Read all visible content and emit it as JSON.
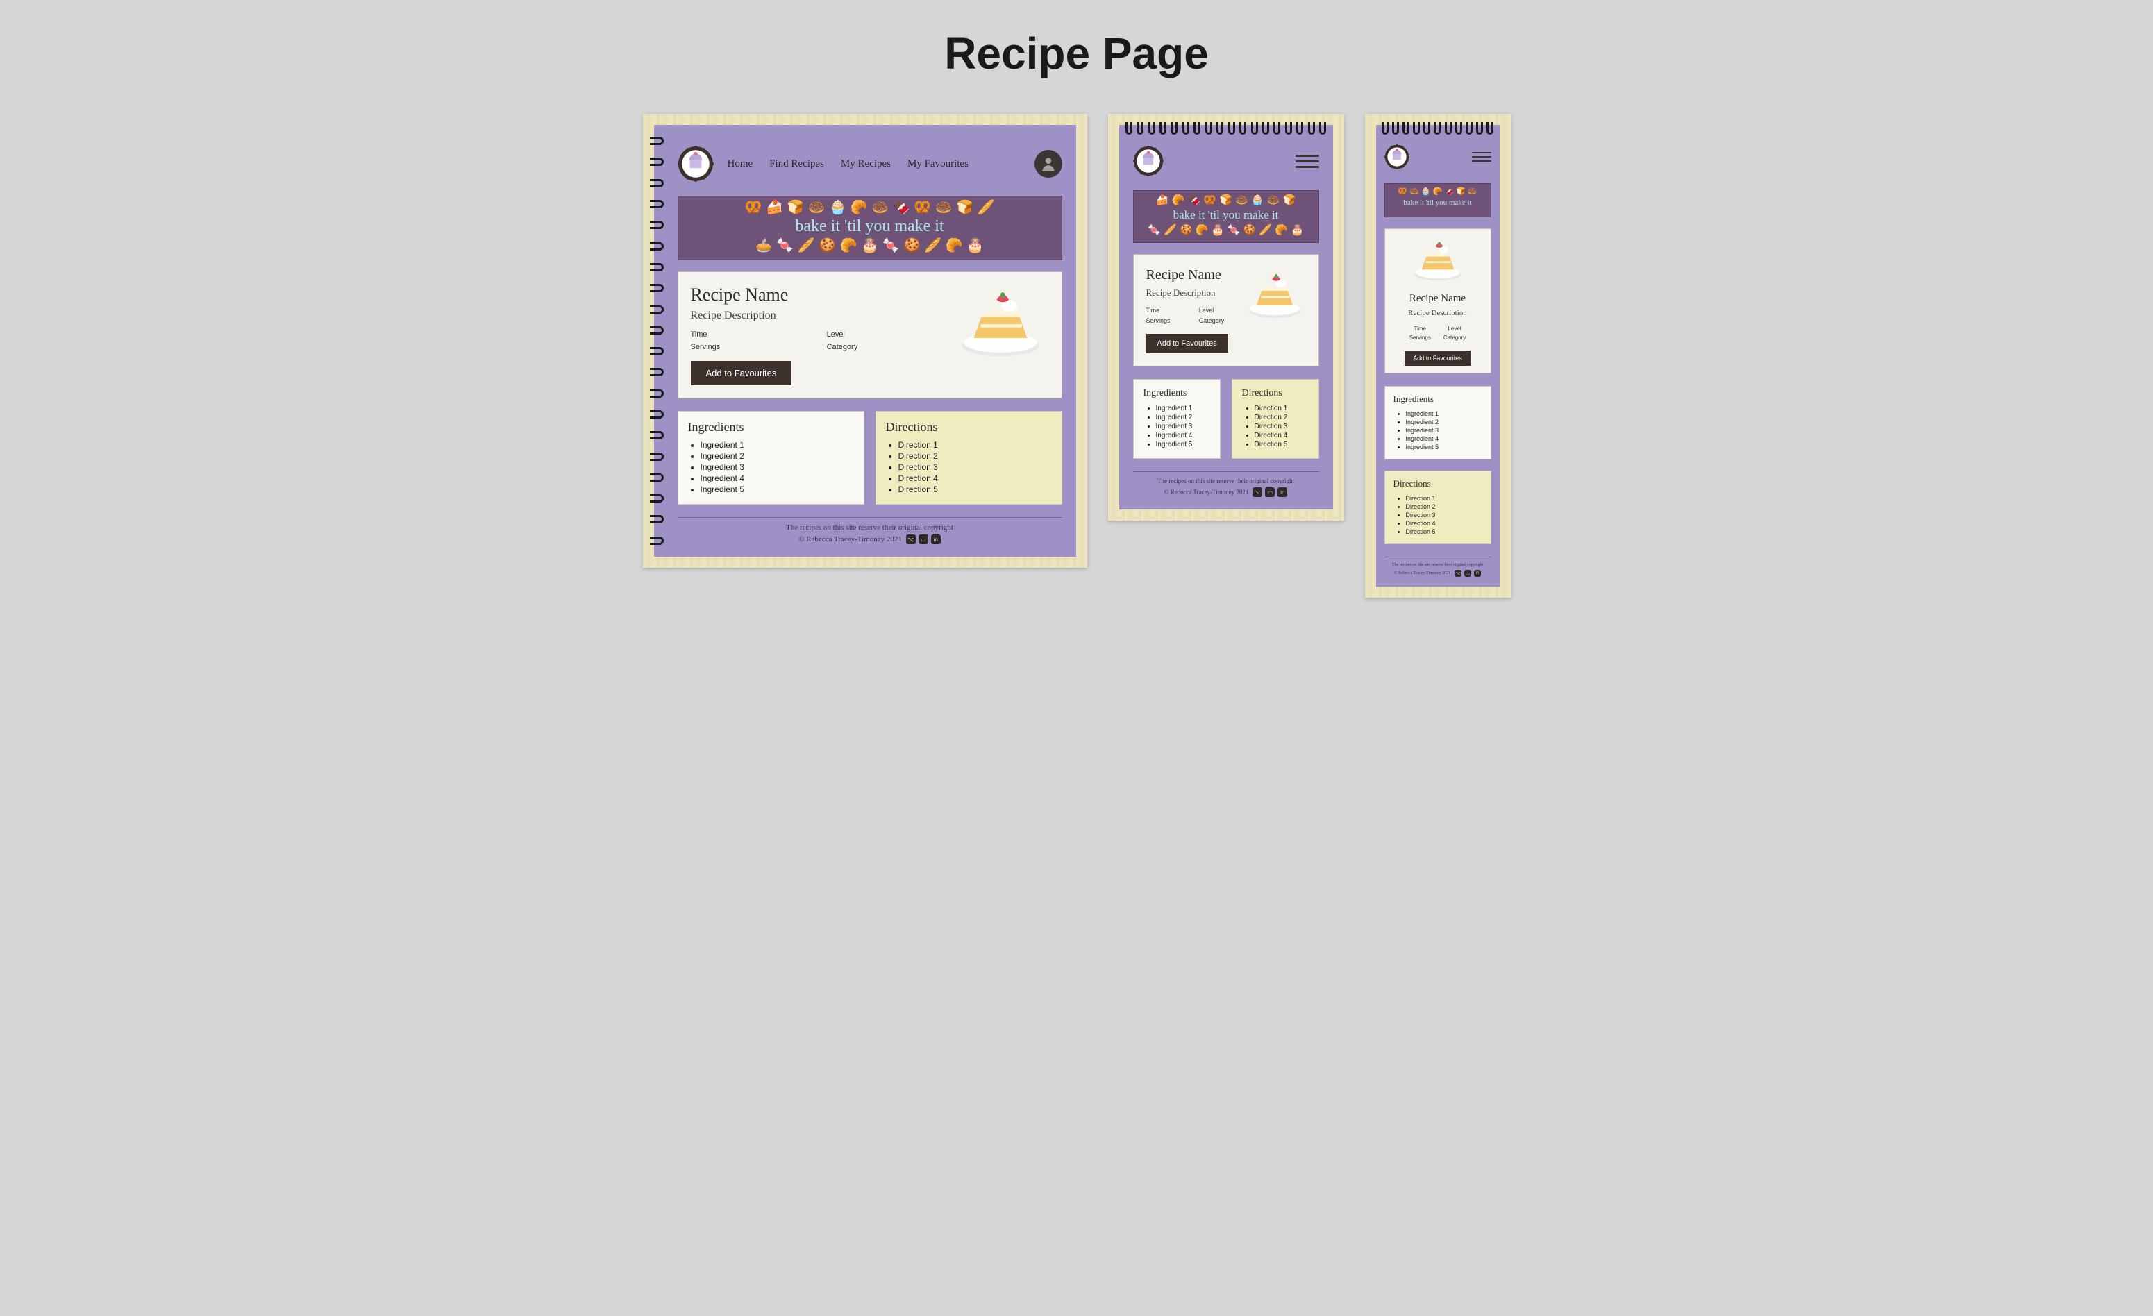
{
  "page_title": "Recipe Page",
  "nav": {
    "items": [
      "Home",
      "Find Recipes",
      "My Recipes",
      "My Favourites"
    ]
  },
  "banner": {
    "tagline": "bake it 'til you make it"
  },
  "recipe": {
    "name": "Recipe Name",
    "description": "Recipe Description",
    "meta": {
      "time_label": "Time",
      "level_label": "Level",
      "servings_label": "Servings",
      "category_label": "Category"
    },
    "fav_button": "Add to Favourites"
  },
  "ingredients": {
    "heading": "Ingredients",
    "items": [
      "Ingredient 1",
      "Ingredient 2",
      "Ingredient 3",
      "Ingredient 4",
      "Ingredient 5"
    ]
  },
  "directions": {
    "heading": "Directions",
    "items": [
      "Direction 1",
      "Direction 2",
      "Direction 3",
      "Direction 4",
      "Direction 5"
    ]
  },
  "footer": {
    "copyright_notice": "The recipes on this site reserve their original copyright",
    "credit": "© Rebecca Tracey-Timoney 2021"
  }
}
